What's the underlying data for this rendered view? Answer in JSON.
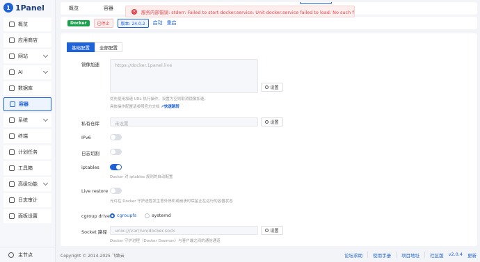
{
  "app": {
    "logo_text": "1Panel",
    "logo_mark": "1"
  },
  "sidebar": {
    "items": [
      {
        "label": "概览",
        "icon": "dashboard-icon",
        "chevron": false,
        "active": false
      },
      {
        "label": "应用商店",
        "icon": "app-store-icon",
        "chevron": false,
        "active": false
      },
      {
        "label": "网站",
        "icon": "globe-icon",
        "chevron": true,
        "active": false
      },
      {
        "label": "AI",
        "icon": "ai-icon",
        "chevron": true,
        "active": false
      },
      {
        "label": "数据库",
        "icon": "database-icon",
        "chevron": false,
        "active": false
      },
      {
        "label": "容器",
        "icon": "container-icon",
        "chevron": false,
        "active": true
      },
      {
        "label": "系统",
        "icon": "system-icon",
        "chevron": true,
        "active": false
      },
      {
        "label": "终端",
        "icon": "terminal-icon",
        "chevron": false,
        "active": false
      },
      {
        "label": "计划任务",
        "icon": "calendar-icon",
        "chevron": false,
        "active": false
      },
      {
        "label": "工具箱",
        "icon": "toolbox-icon",
        "chevron": false,
        "active": false
      },
      {
        "label": "高级功能",
        "icon": "advanced-icon",
        "chevron": true,
        "active": false
      },
      {
        "label": "日志审计",
        "icon": "log-icon",
        "chevron": false,
        "active": false
      },
      {
        "label": "面板设置",
        "icon": "settings-icon",
        "chevron": false,
        "active": false
      }
    ],
    "footer_label": "主节点"
  },
  "topbar": {
    "tabs": [
      "概览",
      "容器"
    ]
  },
  "toast": {
    "icon": "×",
    "message": "服务内部错误: stderr: Failed to start docker.service: Unit docker.service failed to load: No such file or directory."
  },
  "status": {
    "docker": "Docker",
    "state": "已停止",
    "version": "版本: 24.0.2",
    "start": "启动",
    "restart": "重启"
  },
  "subtabs": {
    "basic": "基础配置",
    "all": "全部配置"
  },
  "form": {
    "mirror": {
      "label": "镜像加速",
      "placeholder": "https://docker.1panel.live",
      "button": "设置",
      "help1": "优先使用加速 URL 执行操作，设置为空则取消镜像加速。",
      "help2": "具体操作配置请参照官方文档",
      "help_link": "↗快速跳转"
    },
    "registry": {
      "label": "私有仓库",
      "placeholder": "未设置",
      "button": "设置"
    },
    "ipv6": {
      "label": "IPv6",
      "on": false
    },
    "log_cut": {
      "label": "日志切割",
      "on": false
    },
    "iptables": {
      "label": "iptables",
      "on": true,
      "help": "Docker 对 iptables 规则的自动配置"
    },
    "live_restore": {
      "label": "Live restore",
      "on": false,
      "help": "允许在 Docker 守护进程发生意外停机或崩溃时保留正在运行的容器状态"
    },
    "cgroup": {
      "label": "cgroup driver",
      "options": [
        "cgroupfs",
        "systemd"
      ],
      "selected": "cgroupfs"
    },
    "socket": {
      "label": "Socket 路径",
      "placeholder": "unix:///var/run/docker.sock",
      "button": "设置",
      "help": "Docker 守护进程（Docker Daemon）与客户端之间的通信通道"
    }
  },
  "footer": {
    "copyright": "Copyright © 2014-2025 飞致云",
    "links": [
      "论坛求助",
      "使用手册",
      "项目地址",
      "社区版"
    ],
    "version": "v2.0.4",
    "update": "更新"
  },
  "colors": {
    "accent": "#1d62d6",
    "error": "#e2454b",
    "success": "#17a34a"
  }
}
